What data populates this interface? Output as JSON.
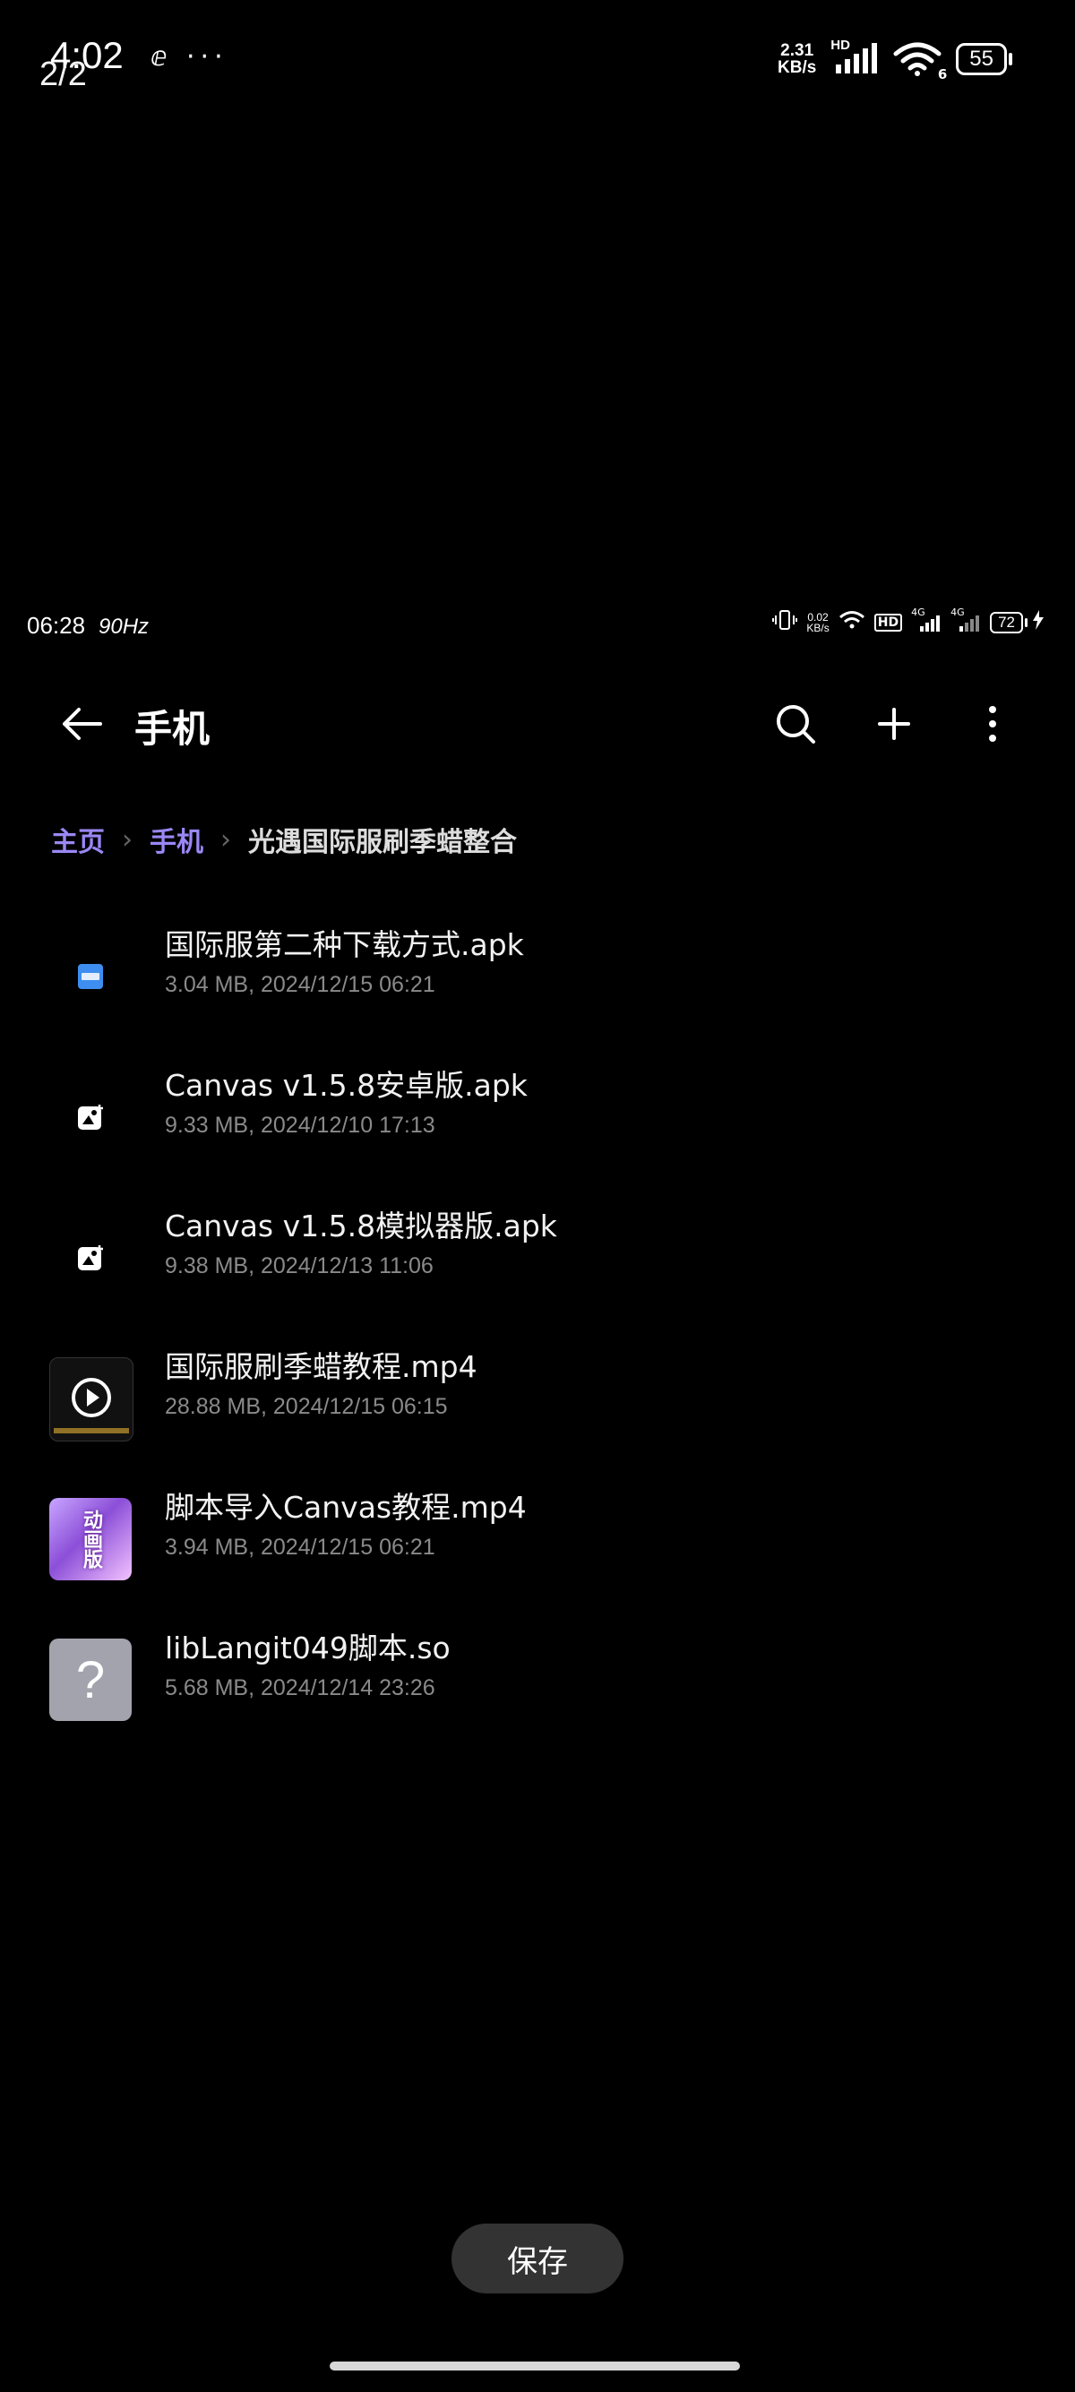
{
  "outer_status": {
    "time": "4:02",
    "page_indicator": "2/2",
    "more_glyph": "···",
    "net_speed_value": "2.31",
    "net_speed_unit": "KB/s",
    "hd_label": "HD",
    "wifi_badge": "6",
    "battery": "55"
  },
  "inner_status": {
    "time": "06:28",
    "refresh_rate": "90Hz",
    "net_speed_value": "0.02",
    "net_speed_unit": "KB/s",
    "hd_label": "HD",
    "net_4g_1": "4G",
    "net_4g_2": "4G",
    "battery": "72"
  },
  "app_bar": {
    "title": "手机",
    "icons": [
      "back-arrow-icon",
      "search-icon",
      "plus-icon",
      "more-vertical-icon"
    ]
  },
  "breadcrumb": {
    "items": [
      "主页",
      "手机",
      "光遇国际服刷季蜡整合"
    ]
  },
  "files": [
    {
      "name": "国际服第二种下载方式.apk",
      "meta": "3.04 MB, 2024/12/15 06:21",
      "icon": "apk-app-icon"
    },
    {
      "name": "Canvas v1.5.8安卓版.apk",
      "meta": "9.33 MB, 2024/12/10 17:13",
      "icon": "apk-app-icon"
    },
    {
      "name": "Canvas v1.5.8模拟器版.apk",
      "meta": "9.38 MB, 2024/12/13 11:06",
      "icon": "apk-app-icon"
    },
    {
      "name": "国际服刷季蜡教程.mp4",
      "meta": "28.88 MB, 2024/12/15 06:15",
      "icon": "video-play-icon"
    },
    {
      "name": "脚本导入Canvas教程.mp4",
      "meta": "3.94 MB, 2024/12/15 06:21",
      "icon": "video-thumbnail"
    },
    {
      "name": "libLangit049脚本.so",
      "meta": "5.68 MB, 2024/12/14 23:26",
      "icon": "unknown-file-icon"
    }
  ],
  "thumb_glyphs": {
    "unknown": "?",
    "video_caption": "动画版"
  },
  "save_button": "保存",
  "colors": {
    "background": "#000000",
    "breadcrumb_link": "#9b87f5",
    "meta_text": "#8a8a8a",
    "save_button_bg": "#333333"
  }
}
